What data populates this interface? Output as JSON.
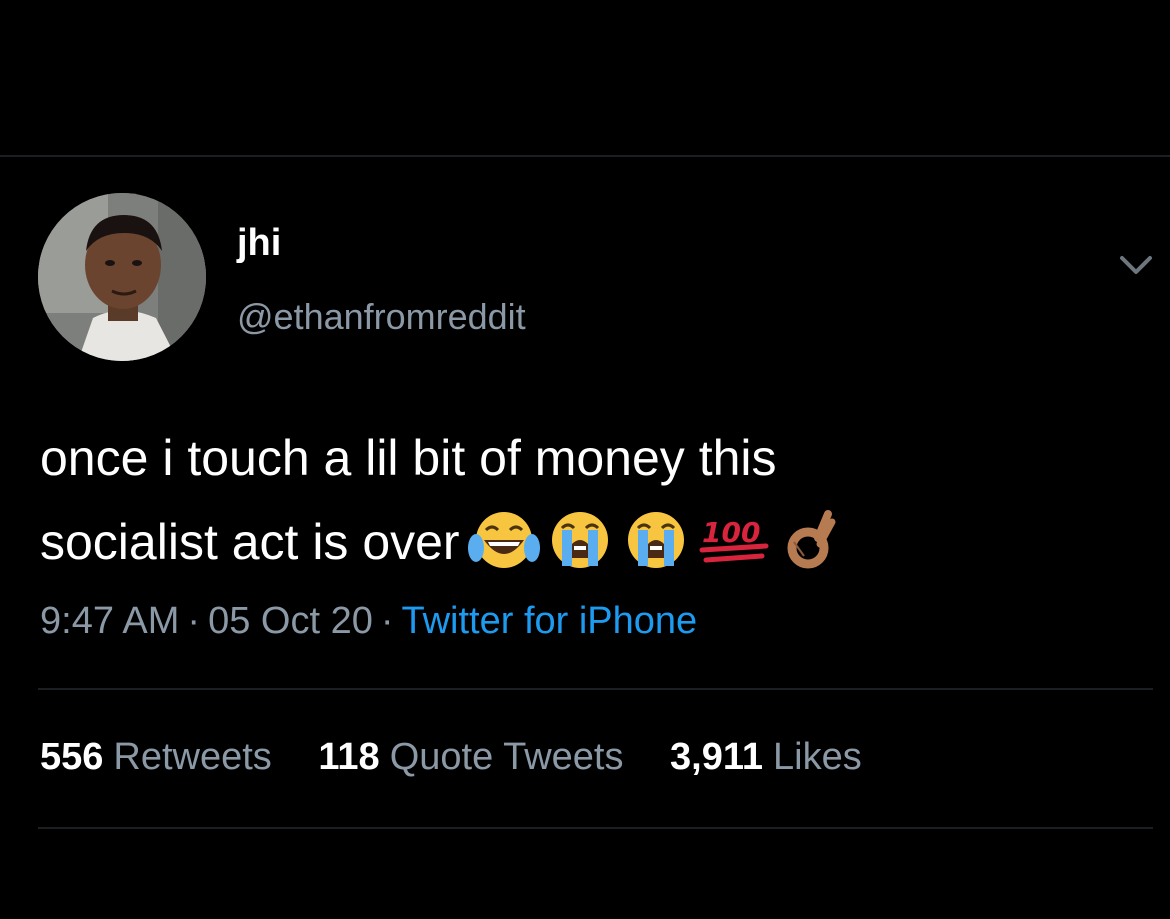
{
  "tweet": {
    "display_name": "jhi",
    "handle": "@ethanfromreddit",
    "text_line_1": "once i touch a lil bit of money this",
    "text_line_2": "socialist act is over",
    "emojis": [
      "face-with-tears-of-joy",
      "loudly-crying-face",
      "loudly-crying-face",
      "hundred-points",
      "ok-hand"
    ],
    "time": "9:47 AM",
    "date": "05 Oct 20",
    "source": "Twitter for iPhone"
  },
  "stats": {
    "retweets_count": "556",
    "retweets_label": "Retweets",
    "quotes_count": "118",
    "quotes_label": "Quote Tweets",
    "likes_count": "3,911",
    "likes_label": "Likes"
  },
  "colors": {
    "background": "#000000",
    "secondary_text": "#8b98a5",
    "link": "#1d9bf0"
  },
  "icons": {
    "more": "chevron-down-icon"
  }
}
